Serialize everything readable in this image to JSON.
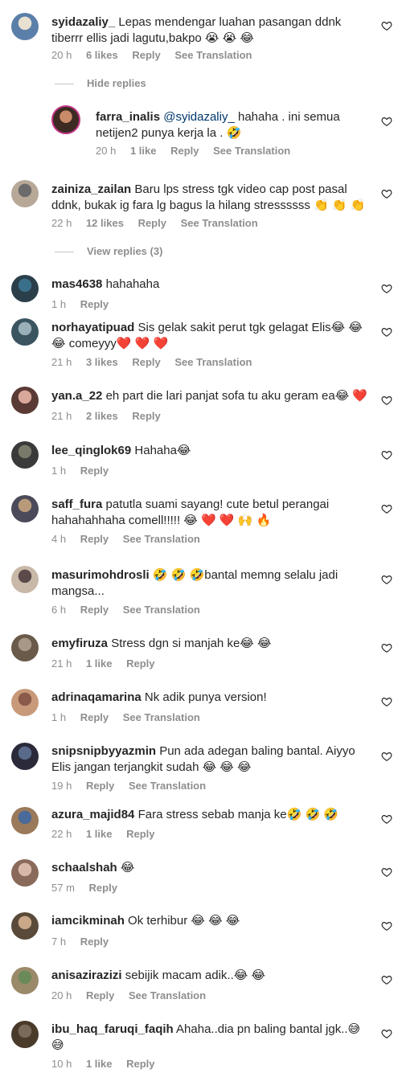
{
  "comments": [
    {
      "user": "syidazaliy_",
      "text": "Lepas mendengar luahan pasangan ddnk tiberrr ellis jadi lagutu,bakpo 😭 😭 😂",
      "time": "20 h",
      "likes": "6 likes",
      "reply": "Reply",
      "translate": "See Translation",
      "av": [
        "#e8e0d0",
        "#5a7fa8"
      ]
    },
    {
      "user": "farra_inalis",
      "mention": "@syidazaliy_",
      "text": " hahaha . ini semua netijen2 punya kerja la . 🤣",
      "time": "20 h",
      "likes": "1 like",
      "reply": "Reply",
      "translate": "See Translation",
      "av": [
        "#c98a6a",
        "#3d2a22"
      ]
    },
    {
      "user": "zainiza_zailan",
      "text": "Baru lps stress tgk video cap post pasal ddnk, bukak ig fara lg bagus la hilang stressssss 👏 👏 👏",
      "time": "22 h",
      "likes": "12 likes",
      "reply": "Reply",
      "translate": "See Translation",
      "av": [
        "#6b6b6b",
        "#b8a898"
      ]
    },
    {
      "user": "mas4638",
      "text": "hahahaha",
      "time": "1 h",
      "likes": "",
      "reply": "Reply",
      "translate": "",
      "av": [
        "#3a6f8a",
        "#2a3f4a"
      ]
    },
    {
      "user": "norhayatipuad",
      "text": "Sis gelak sakit perut tgk gelagat Elis😂 😂 😂 comeyyy❤️ ❤️ ❤️",
      "time": "21 h",
      "likes": "3 likes",
      "reply": "Reply",
      "translate": "See Translation",
      "av": [
        "#9ab0b8",
        "#3a5560"
      ]
    },
    {
      "user": "yan.a_22",
      "text": "eh part die lari panjat sofa tu aku geram ea😂 ❤️",
      "time": "21 h",
      "likes": "2 likes",
      "reply": "Reply",
      "translate": "",
      "av": [
        "#d9a89a",
        "#5a3a34"
      ]
    },
    {
      "user": "lee_qinglok69",
      "text": "Hahaha😂",
      "time": "1 h",
      "likes": "",
      "reply": "Reply",
      "translate": "",
      "av": [
        "#7a7a6a",
        "#3a3a3a"
      ]
    },
    {
      "user": "saff_fura",
      "text": "patutla suami sayang! cute betul perangai hahahahhaha comell!!!!! 😂 ❤️ ❤️ 🙌 🔥",
      "time": "4 h",
      "likes": "",
      "reply": "Reply",
      "translate": "See Translation",
      "av": [
        "#b89a7a",
        "#4a4a5a"
      ]
    },
    {
      "user": "masurimohdrosli",
      "text": "🤣 🤣 🤣bantal memng selalu jadi mangsa...",
      "time": "6 h",
      "likes": "",
      "reply": "Reply",
      "translate": "See Translation",
      "av": [
        "#5a4a4a",
        "#c8b8a8"
      ]
    },
    {
      "user": "emyfiruza",
      "text": "Stress dgn si manjah ke😂 😂",
      "time": "21 h",
      "likes": "1 like",
      "reply": "Reply",
      "translate": "",
      "av": [
        "#a89888",
        "#6a5a4a"
      ]
    },
    {
      "user": "adrinaqamarina",
      "text": "Nk adik punya version!",
      "time": "1 h",
      "likes": "",
      "reply": "Reply",
      "translate": "See Translation",
      "av": [
        "#8a5a4a",
        "#c89a7a"
      ]
    },
    {
      "user": "snipsnipbyyazmin",
      "text": "Pun ada adegan baling bantal. Aiyyo Elis jangan terjangkit sudah 😂 😂 😂",
      "time": "19 h",
      "likes": "",
      "reply": "Reply",
      "translate": "See Translation",
      "av": [
        "#5a6a8a",
        "#2a2a3a"
      ]
    },
    {
      "user": "azura_majid84",
      "text": "Fara stress sebab manja ke🤣 🤣 🤣",
      "time": "22 h",
      "likes": "1 like",
      "reply": "Reply",
      "translate": "",
      "av": [
        "#4a6a9a",
        "#9a7a5a"
      ]
    },
    {
      "user": "schaalshah",
      "text": "😂",
      "time": "57 m",
      "likes": "",
      "reply": "Reply",
      "translate": "",
      "av": [
        "#d8b8a8",
        "#8a6a5a"
      ]
    },
    {
      "user": "iamcikminah",
      "text": "Ok terhibur 😂 😂 😂",
      "time": "7 h",
      "likes": "",
      "reply": "Reply",
      "translate": "",
      "av": [
        "#c8a888",
        "#5a4a3a"
      ]
    },
    {
      "user": "anisazirazizi",
      "text": "sebijik macam adik..😂 😂",
      "time": "20 h",
      "likes": "",
      "reply": "Reply",
      "translate": "See Translation",
      "av": [
        "#6a8a5a",
        "#9a8a6a"
      ]
    },
    {
      "user": "ibu_haq_faruqi_faqih",
      "text": "Ahaha..dia pn baling bantal jgk..😅 😅",
      "time": "10 h",
      "likes": "1 like",
      "reply": "Reply",
      "translate": "",
      "av": [
        "#7a6a5a",
        "#4a3a2a"
      ]
    }
  ],
  "toggles": {
    "hide_replies": "Hide replies",
    "view_replies": "View replies (3)"
  }
}
